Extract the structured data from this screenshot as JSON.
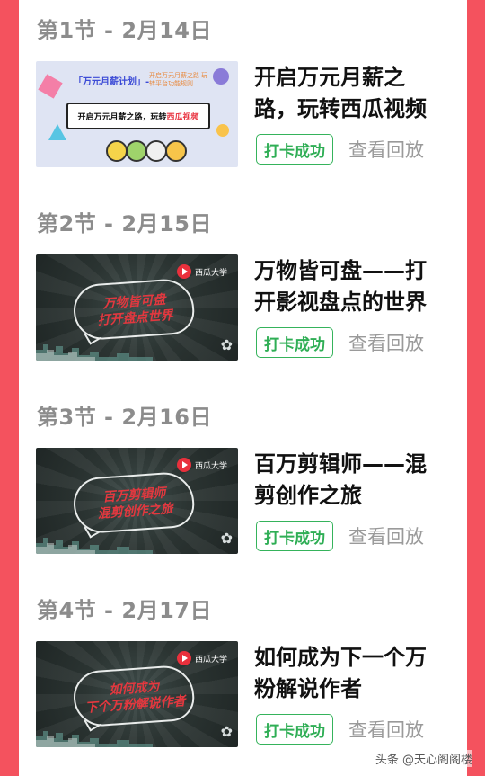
{
  "sessions": [
    {
      "section_title": "第1节 - 2月14日",
      "title": "开启万元月薪之路，玩转西瓜视频",
      "checkin_label": "打卡成功",
      "replay_label": "查看回放",
      "thumbnail": {
        "style": "light",
        "tag": "「万元月薪计划」-",
        "subtitle": "开启万元月薪之路 玩转平台功能规则",
        "banner_main": "开启万元月薪之路，玩转",
        "banner_highlight": "西瓜视频"
      }
    },
    {
      "section_title": "第2节 - 2月15日",
      "title": "万物皆可盘——打开影视盘点的世界",
      "checkin_label": "打卡成功",
      "replay_label": "查看回放",
      "thumbnail": {
        "style": "dark",
        "brand": "西瓜大学",
        "text": "万物皆可盘\n打开盘点世界"
      }
    },
    {
      "section_title": "第3节 - 2月16日",
      "title": "百万剪辑师——混剪创作之旅",
      "checkin_label": "打卡成功",
      "replay_label": "查看回放",
      "thumbnail": {
        "style": "dark",
        "brand": "西瓜大学",
        "text": "百万剪辑师\n混剪创作之旅"
      }
    },
    {
      "section_title": "第4节 - 2月17日",
      "title": "如何成为下一个万粉解说作者",
      "checkin_label": "打卡成功",
      "replay_label": "查看回放",
      "thumbnail": {
        "style": "dark",
        "brand": "西瓜大学",
        "text": "如何成为\n下个万粉解说作者"
      }
    }
  ],
  "watermark": "头条 @天心阁阁楼",
  "colors": {
    "frame": "#f4525e",
    "checkin_green": "#2fae55",
    "thumbnail_text_red": "#e2383f"
  }
}
